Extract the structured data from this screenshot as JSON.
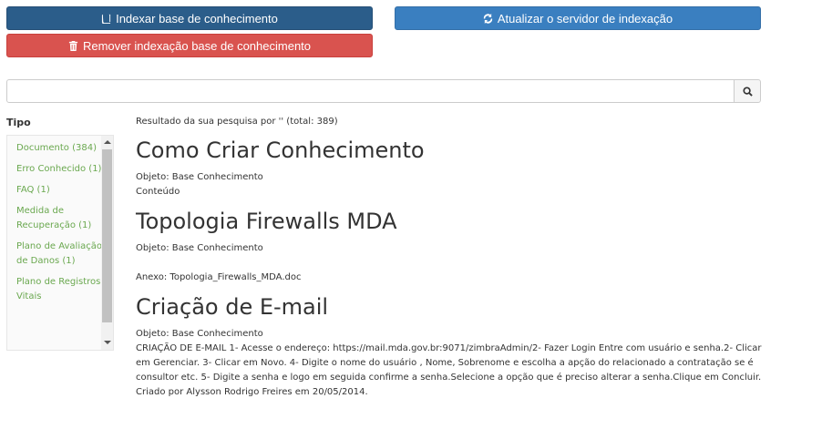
{
  "toolbar": {
    "index_label": "Indexar base de conhecimento",
    "update_label": "Atualizar o servidor de indexação",
    "remove_label": "Remover indexação base de conhecimento"
  },
  "search": {
    "value": "",
    "placeholder": ""
  },
  "facets": {
    "title": "Tipo",
    "items": [
      {
        "label": "Documento (384)"
      },
      {
        "label": "Erro Conhecido (1)"
      },
      {
        "label": "FAQ (1)"
      },
      {
        "label": "Medida de Recuperação (1)"
      },
      {
        "label": "Plano de Avaliação de Danos (1)"
      },
      {
        "label": "Plano de Registros Vitais"
      }
    ]
  },
  "results": {
    "summary": "Resultado da sua pesquisa por '' (total: 389)",
    "items": [
      {
        "title": "Como Criar Conhecimento",
        "object": "Objeto: Base Conhecimento",
        "content": "Conteúdo"
      },
      {
        "title": "Topologia Firewalls MDA",
        "object": "Objeto: Base Conhecimento",
        "attachment": "Anexo: Topologia_Firewalls_MDA.doc"
      },
      {
        "title": "Criação de E-mail",
        "object": "Objeto: Base Conhecimento",
        "content": " CRIAÇÃO DE E-MAIL 1- Acesse o endereço: https://mail.mda.gov.br:9071/zimbraAdmin/2- Fazer Login Entre com usuário e senha.2- Clicar em Gerenciar. 3- Clicar em Novo. 4- Digite o nome do usuário , Nome, Sobrenome e escolha a apção do relacionado a contratação se é consultor etc. 5- Digite a senha e logo em seguida confirme a senha.Selecione a opção que é preciso alterar a senha.Clique em Concluir. Criado por Alysson Rodrigo Freires em 20/05/2014."
      }
    ]
  },
  "icons": {
    "index": "book-icon",
    "update": "refresh-icon",
    "remove": "trash-icon",
    "search": "search-icon"
  }
}
